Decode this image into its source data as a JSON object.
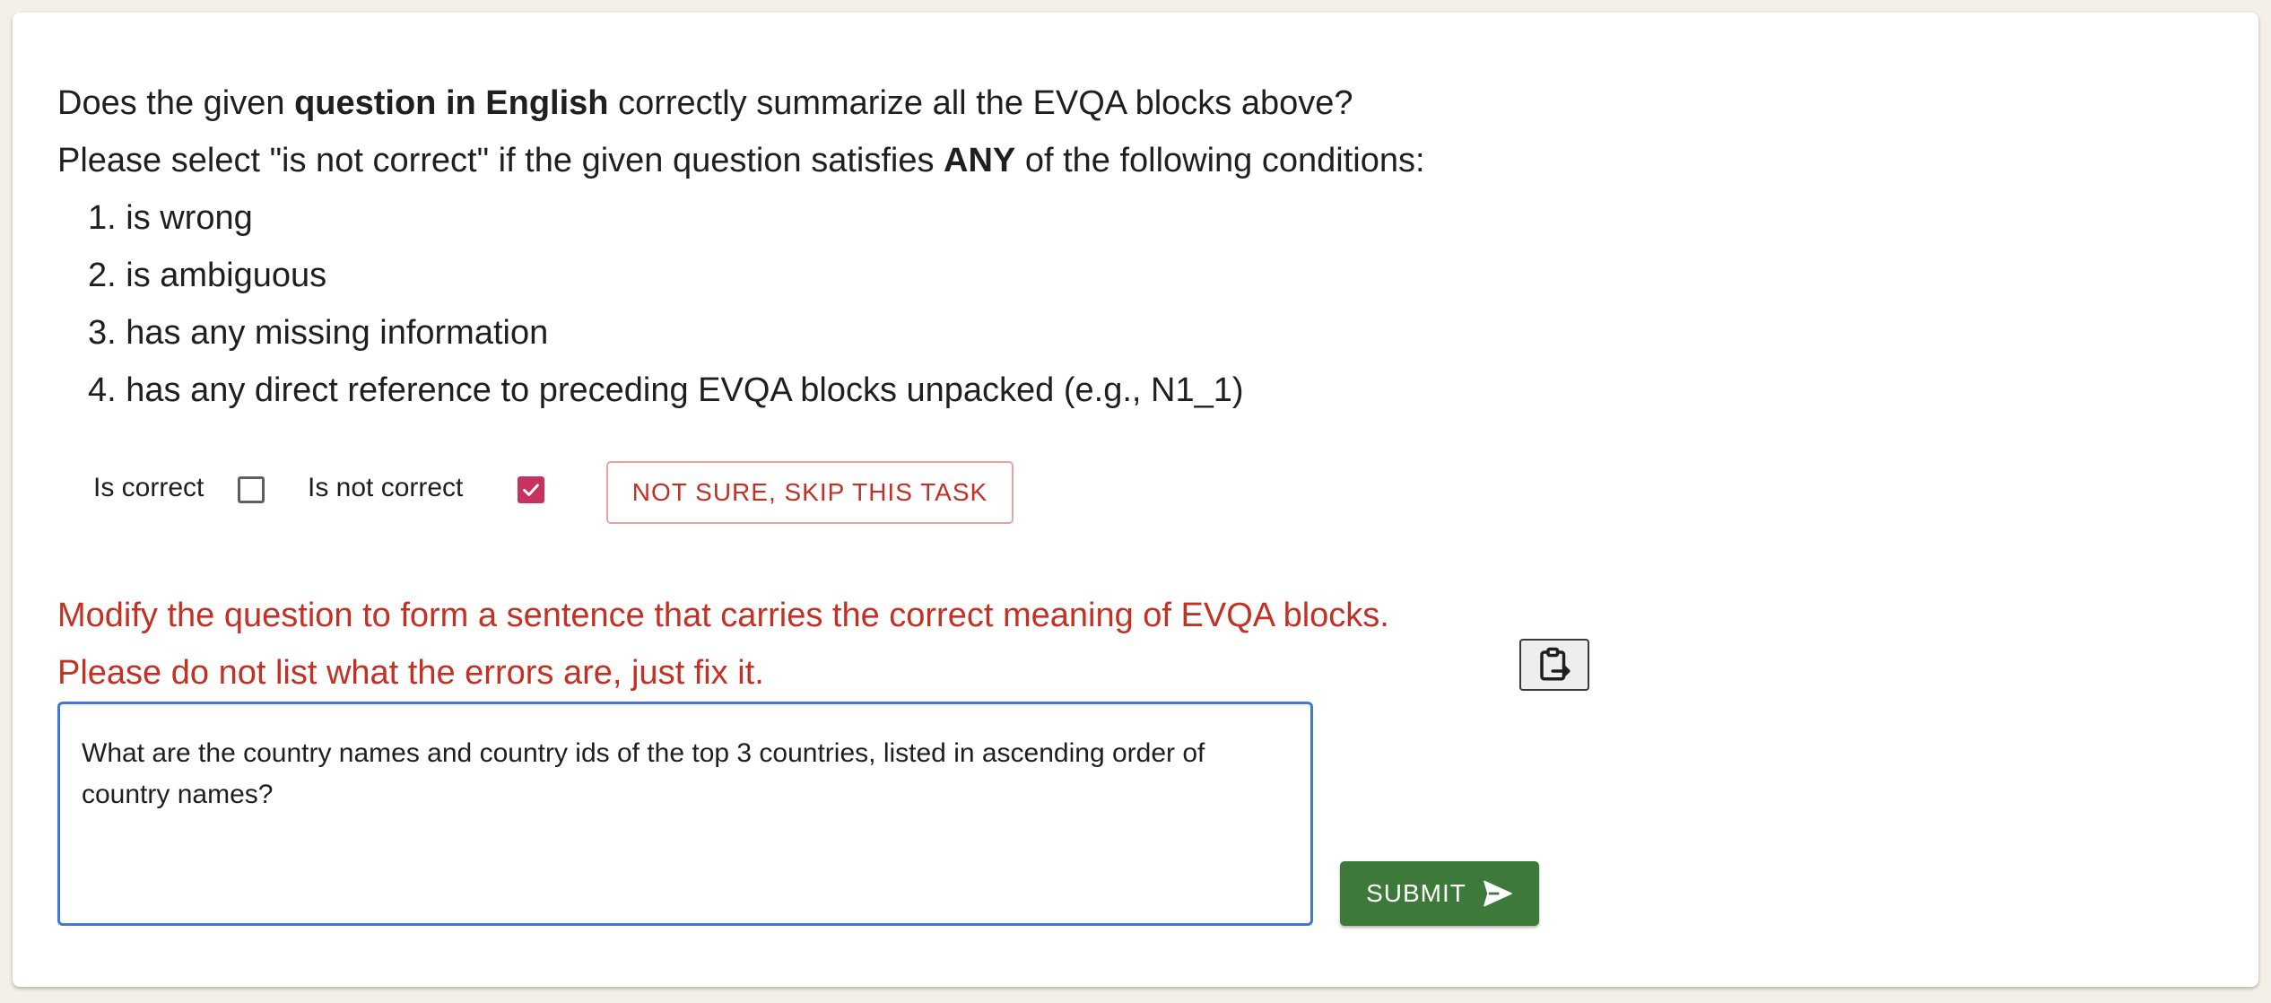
{
  "question_prompt": {
    "line1": {
      "before": "Does the given ",
      "bold": "question in English",
      "after": " correctly summarize all the EVQA blocks above?"
    },
    "line2": {
      "before": "Please select \"is not correct\" if the given question satisfies ",
      "bold": "ANY",
      "after": " of the following conditions:"
    },
    "conditions": [
      "1. is wrong",
      "2. is ambiguous",
      "3. has any missing information",
      "4. has any direct reference to preceding EVQA blocks unpacked (e.g., N1_1)"
    ]
  },
  "choices": {
    "correct_label": "Is correct",
    "correct_checked": false,
    "not_correct_label": "Is not correct",
    "not_correct_checked": true,
    "skip_label": "NOT SURE, SKIP THIS TASK"
  },
  "modify": {
    "instruction1": "Modify the question to form a sentence that carries the correct meaning of EVQA blocks.",
    "instruction2": "Please do not list what the errors are, just fix it.",
    "answer_value": "What are the country names and country ids of the top 3 countries, listed in ascending order of country names?",
    "paste_icon": "clipboard-paste-icon",
    "submit_label": "SUBMIT",
    "submit_icon": "send-icon"
  },
  "colors": {
    "checkbox_checked": "#c8325f",
    "error_text": "#c33124",
    "submit": "#3d7a3a",
    "focus_border": "#3e7bd0"
  }
}
